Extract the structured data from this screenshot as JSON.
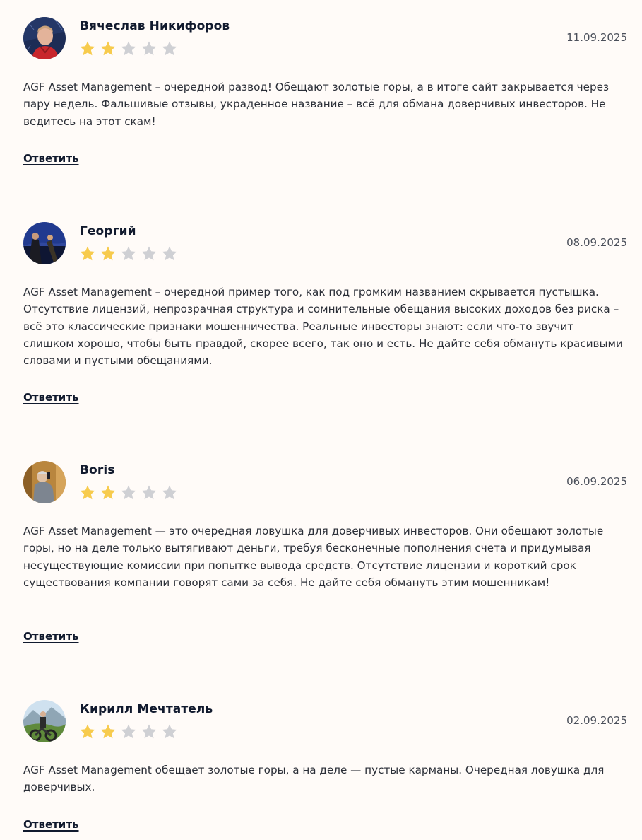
{
  "reviews": [
    {
      "author": "Вячеслав Никифоров",
      "date": "11.09.2025",
      "rating": 2,
      "max_rating": 5,
      "text": "AGF Asset Management – очередной развод! Обещают золотые горы, а в итоге сайт закрывается через пару недель. Фальшивые отзывы, украденное название – всё для обмана доверчивых инвесторов. Не ведитесь на этот скам!",
      "reply_label": "Ответить"
    },
    {
      "author": "Георгий",
      "date": "08.09.2025",
      "rating": 2,
      "max_rating": 5,
      "text": "AGF Asset Management – очередной пример того, как под громким названием скрывается пустышка. Отсутствие лицензий, непрозрачная структура и сомнительные обещания высоких доходов без риска – всё это классические признаки мошенничества. Реальные инвесторы знают: если что-то звучит слишком хорошо, чтобы быть правдой, скорее всего, так оно и есть. Не дайте себя обмануть красивыми словами и пустыми обещаниями.",
      "reply_label": "Ответить"
    },
    {
      "author": "Boris",
      "date": "06.09.2025",
      "rating": 2,
      "max_rating": 5,
      "text": "AGF Asset Management — это очередная ловушка для доверчивых инвесторов. Они обещают золотые горы, но на деле только вытягивают деньги, требуя бесконечные пополнения счета и придумывая несуществующие комиссии при попытке вывода средств. Отсутствие лицензии и короткий срок существования компании говорят сами за себя. Не дайте себя обмануть этим мошенникам!",
      "reply_label": "Ответить"
    },
    {
      "author": "Кирилл Мечтатель",
      "date": "02.09.2025",
      "rating": 2,
      "max_rating": 5,
      "text": "AGF Asset Management обещает золотые горы, а на деле — пустые карманы. Очередная ловушка для доверчивых.",
      "reply_label": "Ответить"
    }
  ],
  "colors": {
    "star_filled": "#f7cb4d",
    "star_empty": "#cfd0d4",
    "background": "#fffbf8"
  },
  "icons": {
    "star": "star-icon"
  }
}
